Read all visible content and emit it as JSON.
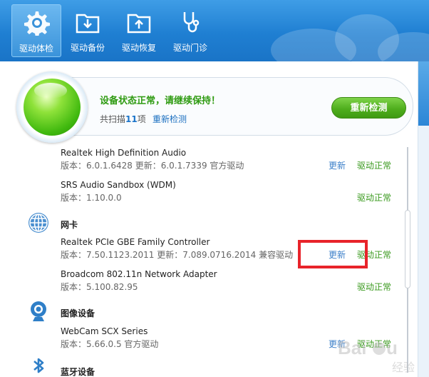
{
  "nav": [
    {
      "label": "驱动体检",
      "icon": "gear-icon",
      "active": true
    },
    {
      "label": "驱动备份",
      "icon": "folder-download-icon",
      "active": false
    },
    {
      "label": "驱动恢复",
      "icon": "folder-upload-icon",
      "active": false
    },
    {
      "label": "驱动门诊",
      "icon": "stethoscope-icon",
      "active": false
    }
  ],
  "status": {
    "message": "设备状态正常，请继续保持！",
    "scan_prefix": "共扫描",
    "scan_count": "11",
    "scan_suffix": "项",
    "rescan_link": "重新检测",
    "rescan_button": "重新检测"
  },
  "drivers": [
    {
      "name": "Realtek High Definition Audio",
      "version": "版本：6.0.1.6428 更新：6.0.1.7339 官方驱动",
      "update": "更新",
      "status": "驱动正常"
    },
    {
      "name": "SRS Audio Sandbox (WDM)",
      "version": "版本：1.10.0.0",
      "update": "",
      "status": "驱动正常"
    },
    {
      "name": "Realtek PCIe GBE Family Controller",
      "version": "版本：7.50.1123.2011 更新：7.089.0716.2014 兼容驱动",
      "update": "更新",
      "status": "驱动正常"
    },
    {
      "name": "Broadcom 802.11n Network Adapter",
      "version": "版本：5.100.82.95",
      "update": "",
      "status": "驱动正常"
    },
    {
      "name": "WebCam SCX Series",
      "version": "版本：5.66.0.5 官方驱动",
      "update": "更新",
      "status": "驱动正常"
    }
  ],
  "categories": [
    {
      "label": "网卡",
      "icon": "globe-icon"
    },
    {
      "label": "图像设备",
      "icon": "webcam-icon"
    },
    {
      "label": "蓝牙设备",
      "icon": "bluetooth-icon"
    }
  ],
  "watermark": "Baidu 经验",
  "colors": {
    "accent_blue": "#1f7fd2",
    "ok_green": "#3a9a1e",
    "link_blue": "#3b7fc9",
    "highlight_red": "#e8232a"
  }
}
